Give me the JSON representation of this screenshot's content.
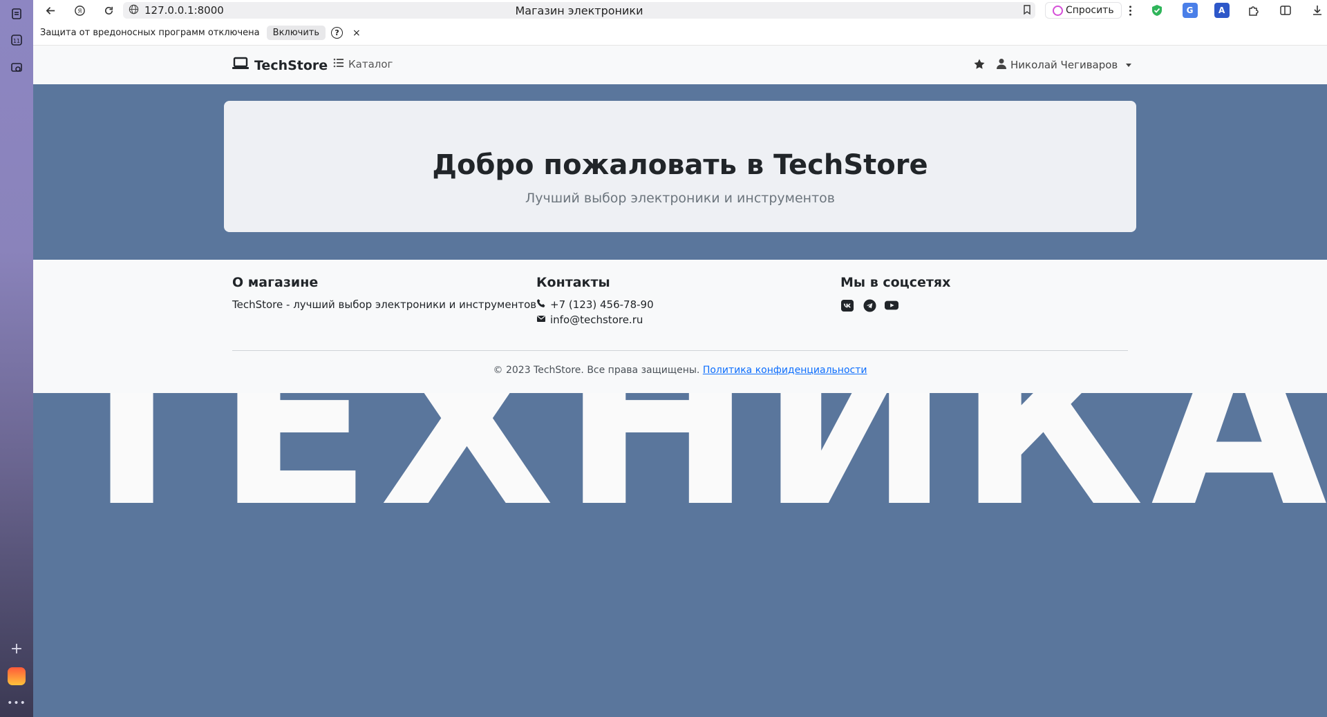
{
  "browser": {
    "url": "127.0.0.1:8000",
    "tab_title": "Магазин электроники",
    "ask_label": "Спросить",
    "notice": {
      "text": "Защита от вредоносных программ отключена",
      "enable_label": "Включить",
      "help_label": "?",
      "close_label": "×"
    },
    "sidepanel": {
      "calendar_day": "11"
    }
  },
  "navbar": {
    "brand": "TechStore",
    "catalog_label": "Каталог",
    "user_name": "Николай Чегиваров"
  },
  "hero": {
    "title": "Добро пожаловать в TechStore",
    "subtitle": "Лучший выбор электроники и инструментов"
  },
  "footer": {
    "about_title": "О магазине",
    "about_text": "TechStore - лучший выбор электроники и инструментов",
    "contacts_title": "Контакты",
    "phone": "+7 (123) 456-78-90",
    "email": "info@techstore.ru",
    "social_title": "Мы в соцсетях",
    "copyright": "© 2023 TechStore. Все права защищены.",
    "privacy_link": "Политика конфиденциальности"
  },
  "background": {
    "big_word": "ТЕХНИКА"
  },
  "colors": {
    "page_bg": "#5a769c",
    "hero_bg": "#eef0f4",
    "footer_bg": "#f8f9fa",
    "link": "#0d6efd"
  }
}
